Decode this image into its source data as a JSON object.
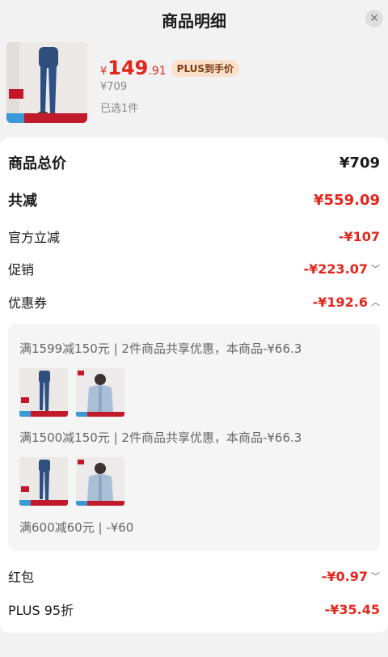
{
  "header": {
    "title": "商品明细"
  },
  "product": {
    "price_symbol": "¥",
    "price_integer": "149",
    "price_decimal": ".91",
    "plus_badge": "PLUS到手价",
    "original_price": "¥709",
    "selected_count": "已选1件"
  },
  "summary": {
    "total_label": "商品总价",
    "total_value": "¥709",
    "reduction_label": "共减",
    "reduction_value": "¥559.09",
    "official_label": "官方立减",
    "official_value": "-¥107",
    "promo_label": "促销",
    "promo_value": "-¥223.07",
    "coupon_label": "优惠券",
    "coupon_value": "-¥192.6",
    "redpacket_label": "红包",
    "redpacket_value": "-¥0.97",
    "plus_label": "PLUS 95折",
    "plus_value": "-¥35.45"
  },
  "coupons": [
    {
      "text": "满1599减150元 | 2件商品共享优惠，本商品-¥66.3"
    },
    {
      "text": "满1500减150元 | 2件商品共享优惠，本商品-¥66.3"
    },
    {
      "text": "满600减60元 | -¥60"
    }
  ],
  "colors": {
    "accent_red": "#e3261b",
    "plus_badge_bg": "#fbe0cb"
  },
  "icons": {
    "close": "close-icon",
    "chevron_down": "chevron-down-icon",
    "chevron_up": "chevron-up-icon"
  }
}
